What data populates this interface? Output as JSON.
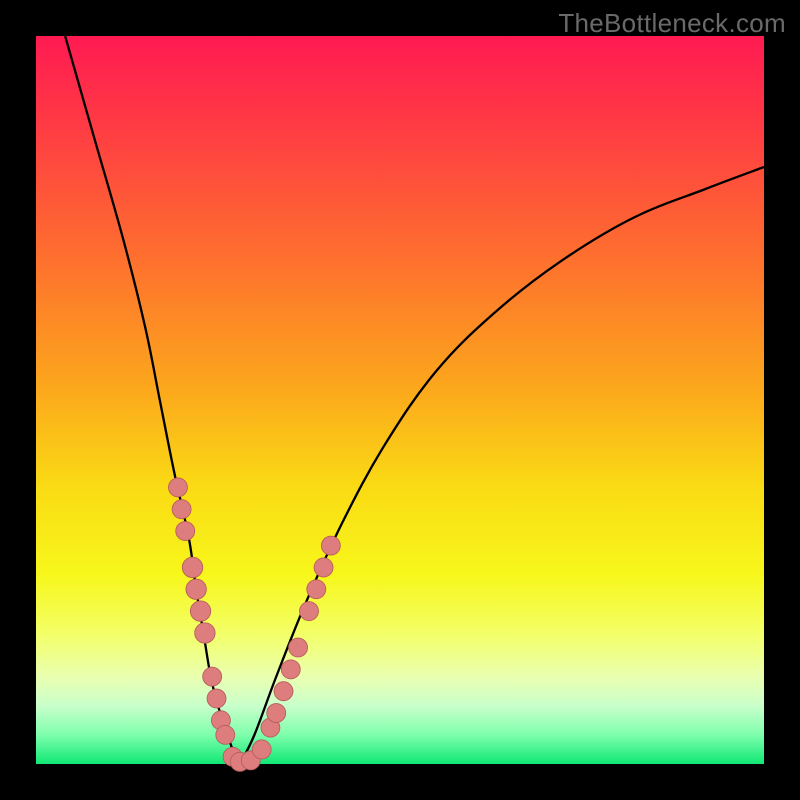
{
  "watermark": "TheBottleneck.com",
  "colors": {
    "frame": "#000000",
    "curve": "#000000",
    "marker_fill": "#de7d7d",
    "marker_stroke": "#b75c5c",
    "gradient_stops": [
      {
        "offset": "0%",
        "color": "#ff1a52"
      },
      {
        "offset": "12%",
        "color": "#ff3a44"
      },
      {
        "offset": "30%",
        "color": "#fe6e2f"
      },
      {
        "offset": "48%",
        "color": "#fca61c"
      },
      {
        "offset": "62%",
        "color": "#fadb14"
      },
      {
        "offset": "74%",
        "color": "#f7f71b"
      },
      {
        "offset": "82%",
        "color": "#f3ff66"
      },
      {
        "offset": "88%",
        "color": "#eaffb0"
      },
      {
        "offset": "92%",
        "color": "#c9ffcb"
      },
      {
        "offset": "96%",
        "color": "#7effac"
      },
      {
        "offset": "100%",
        "color": "#10e874"
      }
    ]
  },
  "chart_data": {
    "type": "line",
    "title": "",
    "xlabel": "",
    "ylabel": "",
    "xlim": [
      0,
      100
    ],
    "ylim": [
      0,
      100
    ],
    "grid": false,
    "legend": false,
    "series": [
      {
        "name": "curve-left",
        "x": [
          4,
          8,
          12,
          15,
          17,
          19,
          21,
          22,
          23,
          24,
          25,
          26,
          27,
          28
        ],
        "y": [
          100,
          86,
          72,
          60,
          50,
          40,
          31,
          24,
          18,
          12,
          8,
          5,
          2,
          0
        ]
      },
      {
        "name": "curve-right",
        "x": [
          28,
          30,
          33,
          37,
          42,
          48,
          55,
          63,
          72,
          82,
          92,
          100
        ],
        "y": [
          0,
          4,
          12,
          22,
          33,
          44,
          54,
          62,
          69,
          75,
          79,
          82
        ]
      }
    ],
    "markers": {
      "name": "beads",
      "points": [
        {
          "x": 19.5,
          "y": 38,
          "r": 1.3
        },
        {
          "x": 20.0,
          "y": 35,
          "r": 1.3
        },
        {
          "x": 20.5,
          "y": 32,
          "r": 1.3
        },
        {
          "x": 21.5,
          "y": 27,
          "r": 1.4
        },
        {
          "x": 22.0,
          "y": 24,
          "r": 1.4
        },
        {
          "x": 22.6,
          "y": 21,
          "r": 1.4
        },
        {
          "x": 23.2,
          "y": 18,
          "r": 1.4
        },
        {
          "x": 24.2,
          "y": 12,
          "r": 1.3
        },
        {
          "x": 24.8,
          "y": 9,
          "r": 1.3
        },
        {
          "x": 25.4,
          "y": 6,
          "r": 1.3
        },
        {
          "x": 26.0,
          "y": 4,
          "r": 1.3
        },
        {
          "x": 27.0,
          "y": 1,
          "r": 1.3
        },
        {
          "x": 28.0,
          "y": 0.3,
          "r": 1.3
        },
        {
          "x": 29.5,
          "y": 0.5,
          "r": 1.3
        },
        {
          "x": 31.0,
          "y": 2,
          "r": 1.3
        },
        {
          "x": 32.2,
          "y": 5,
          "r": 1.3
        },
        {
          "x": 33.0,
          "y": 7,
          "r": 1.3
        },
        {
          "x": 34.0,
          "y": 10,
          "r": 1.3
        },
        {
          "x": 35.0,
          "y": 13,
          "r": 1.3
        },
        {
          "x": 36.0,
          "y": 16,
          "r": 1.3
        },
        {
          "x": 37.5,
          "y": 21,
          "r": 1.3
        },
        {
          "x": 38.5,
          "y": 24,
          "r": 1.3
        },
        {
          "x": 39.5,
          "y": 27,
          "r": 1.3
        },
        {
          "x": 40.5,
          "y": 30,
          "r": 1.3
        }
      ]
    }
  }
}
